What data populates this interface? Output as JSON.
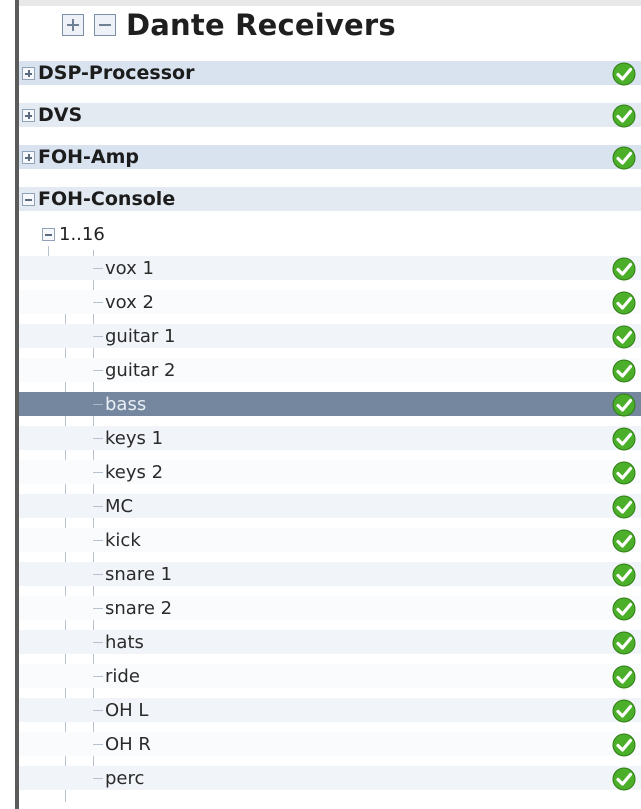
{
  "header": {
    "title": "Dante Receivers"
  },
  "devices": [
    {
      "name": "DSP-Processor",
      "expanded": false
    },
    {
      "name": "DVS",
      "expanded": false
    },
    {
      "name": "FOH-Amp",
      "expanded": false
    },
    {
      "name": "FOH-Console",
      "expanded": true
    }
  ],
  "channel_group": {
    "label": "1..16"
  },
  "channels": [
    "vox 1",
    "vox 2",
    "guitar 1",
    "guitar 2",
    "bass",
    "keys 1",
    "keys 2",
    "MC",
    "kick",
    "snare 1",
    "snare 2",
    "hats",
    "ride",
    "OH L",
    "OH R",
    "perc"
  ],
  "selected_channel": "bass",
  "status_icon": "green-check-icon",
  "colors": {
    "device_row": "#d9e3ef",
    "selected_row": "#74879f",
    "check_green": "#4caf2a"
  }
}
